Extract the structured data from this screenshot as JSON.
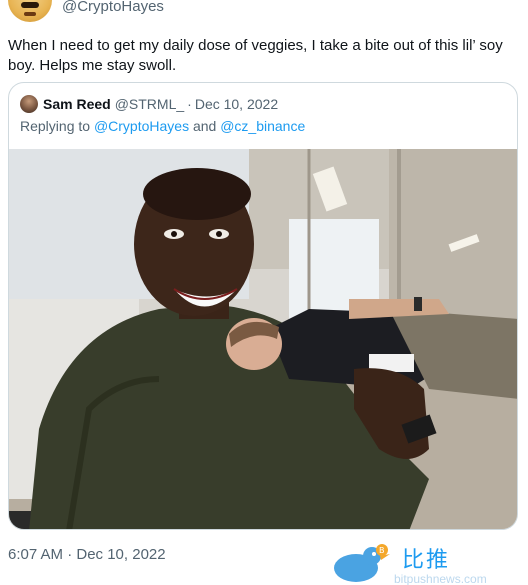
{
  "author": {
    "handle": "@CryptoHayes"
  },
  "tweet": {
    "text": "When I need to get my daily dose of veggies, I take a bite out of this lil’ soy boy. Helps me stay swoll.",
    "timestamp": "6:07 AM · Dec 10, 2022"
  },
  "quoted_tweet": {
    "name": "Sam Reed",
    "handle": "@STRML_",
    "separator": "·",
    "date": "Dec 10, 2022",
    "reply_prefix": "Replying to",
    "mention_1": "@CryptoHayes",
    "reply_and": "and",
    "mention_2": "@cz_binance"
  },
  "watermark": {
    "text": "比推",
    "sub": "bitpushnews.com"
  },
  "colors": {
    "secondary_text": "#536471",
    "link": "#1d9bf0",
    "border": "#cfd9de"
  }
}
